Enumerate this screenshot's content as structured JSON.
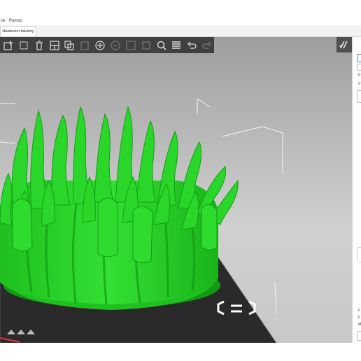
{
  "menu": {
    "items": [
      "ce",
      "Pomoc"
    ]
  },
  "tabs": [
    {
      "label": "Nastavení tiskárny"
    }
  ],
  "toolbar": {
    "icons": [
      "add-icon",
      "delete-icon",
      "delete-all-icon",
      "arrange-icon",
      "copy-icon",
      "paste-icon",
      "add-instance-icon",
      "remove-instance-icon",
      "split-objects-icon",
      "split-parts-icon",
      "search-icon",
      "layers-icon",
      "undo-icon",
      "redo-icon"
    ]
  },
  "sidebar": {
    "letters": [
      "P",
      "V",
      "F",
      "F",
      "M"
    ]
  },
  "colors": {
    "model": "#27d427",
    "model_shadow": "#128c12",
    "bed": "#2b2b2b",
    "toolbar": "#404040",
    "background_top": "#9e9e9e",
    "background_bottom": "#cfcfcf"
  }
}
